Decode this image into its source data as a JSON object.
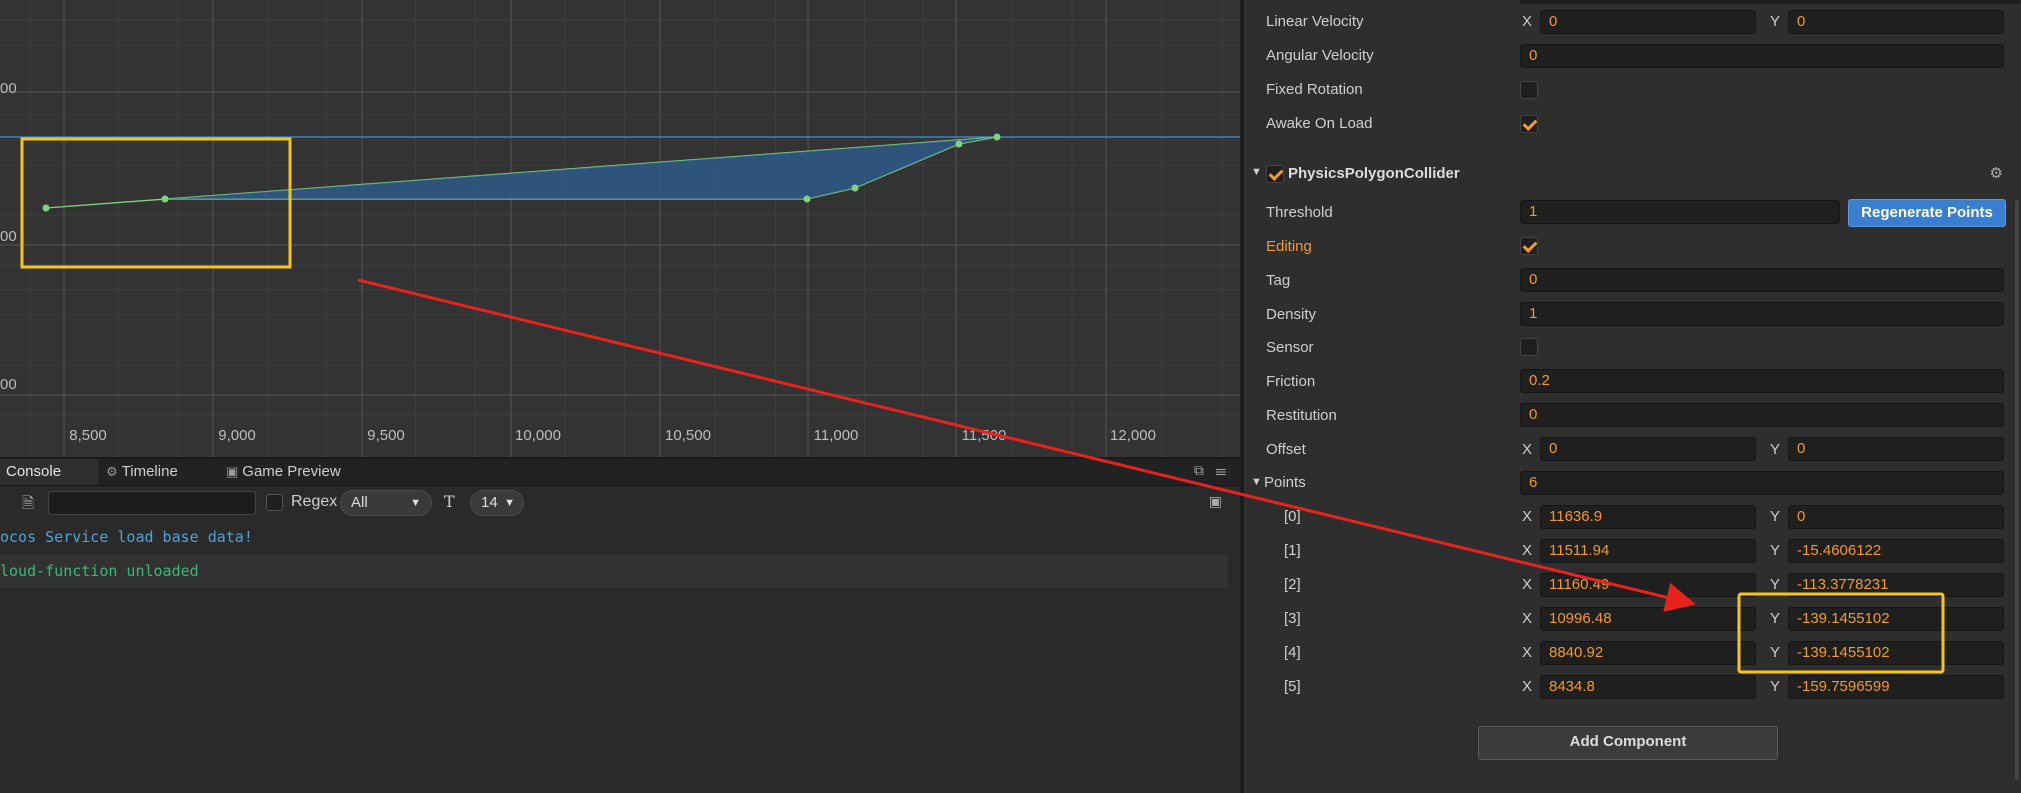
{
  "scene": {
    "x_axis_labels": [
      "8,500",
      "9,000",
      "9,500",
      "10,000",
      "10,500",
      "11,000",
      "11,500",
      "12,000"
    ],
    "y_axis_labels": [
      "00",
      "00",
      "00"
    ]
  },
  "console": {
    "tabs": [
      {
        "label": "Console"
      },
      {
        "label": "Timeline"
      },
      {
        "label": "Game Preview"
      }
    ],
    "regex_label": "Regex",
    "level_select": "All",
    "font_size_select": "14",
    "logs": [
      {
        "text": "ocos Service load base data!",
        "color": "#4fa3d9"
      },
      {
        "text": "loud-function unloaded",
        "color": "#3cb878"
      }
    ]
  },
  "inspector": {
    "linear_velocity": {
      "label": "Linear Velocity",
      "x": "0",
      "y": "0"
    },
    "angular_velocity": {
      "label": "Angular Velocity",
      "value": "0"
    },
    "fixed_rotation": {
      "label": "Fixed Rotation",
      "checked": false
    },
    "awake_on_load": {
      "label": "Awake On Load",
      "checked": true
    },
    "component": {
      "title": "PhysicsPolygonCollider",
      "threshold": {
        "label": "Threshold",
        "value": "1"
      },
      "regenerate_label": "Regenerate Points",
      "editing": {
        "label": "Editing",
        "checked": true
      },
      "tag": {
        "label": "Tag",
        "value": "0"
      },
      "density": {
        "label": "Density",
        "value": "1"
      },
      "sensor": {
        "label": "Sensor",
        "checked": false
      },
      "friction": {
        "label": "Friction",
        "value": "0.2"
      },
      "restitution": {
        "label": "Restitution",
        "value": "0"
      },
      "offset": {
        "label": "Offset",
        "x": "0",
        "y": "0"
      },
      "points": {
        "label": "Points",
        "count": "6",
        "items": [
          {
            "index": "[0]",
            "x": "11636.9",
            "y": "0"
          },
          {
            "index": "[1]",
            "x": "11511.94",
            "y": "-15.4606122"
          },
          {
            "index": "[2]",
            "x": "11160.49",
            "y": "-113.3778231"
          },
          {
            "index": "[3]",
            "x": "10996.48",
            "y": "-139.1455102"
          },
          {
            "index": "[4]",
            "x": "8840.92",
            "y": "-139.1455102"
          },
          {
            "index": "[5]",
            "x": "8434.8",
            "y": "-159.7596599"
          }
        ]
      }
    },
    "add_component_label": "Add Component",
    "x_label": "X",
    "y_label": "Y"
  },
  "colors": {
    "accent_orange": "#f39a2b",
    "highlight_yellow": "#f5c518",
    "annotation_red": "#e8231b",
    "collider_green": "#7ed47e",
    "button_blue": "#3a7ed0"
  }
}
